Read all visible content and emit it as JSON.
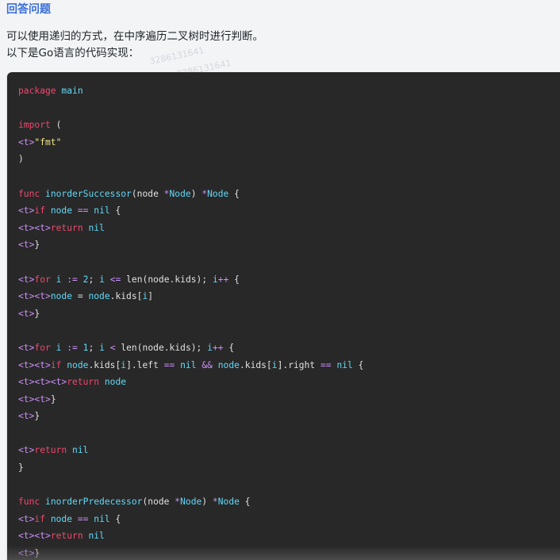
{
  "answer": {
    "heading": "回答问题",
    "intro_line1": "可以使用递归的方式，在中序遍历二叉树时进行判断。",
    "intro_line2": "以下是Go语言的代码实现：",
    "watermark1": "3286131641",
    "watermark2": "3286131641"
  },
  "code": {
    "lines": [
      [
        [
          "kw",
          "package"
        ],
        [
          "pl",
          " "
        ],
        [
          "id",
          "main"
        ]
      ],
      [],
      [
        [
          "kw",
          "import"
        ],
        [
          "pl",
          " ("
        ]
      ],
      [
        [
          "tag",
          "<t>"
        ],
        [
          "str",
          "\"fmt\""
        ]
      ],
      [
        [
          "pl",
          ")"
        ]
      ],
      [],
      [
        [
          "kw",
          "func"
        ],
        [
          "pl",
          " "
        ],
        [
          "id",
          "inorderSuccessor"
        ],
        [
          "pl",
          "(node "
        ],
        [
          "tag",
          "*"
        ],
        [
          "id",
          "Node"
        ],
        [
          "pl",
          ") "
        ],
        [
          "tag",
          "*"
        ],
        [
          "id",
          "Node"
        ],
        [
          "pl",
          " {"
        ]
      ],
      [
        [
          "tag",
          "<t>"
        ],
        [
          "kw",
          "if"
        ],
        [
          "pl",
          " "
        ],
        [
          "id",
          "node"
        ],
        [
          "pl",
          " "
        ],
        [
          "tag",
          "=="
        ],
        [
          "pl",
          " "
        ],
        [
          "id",
          "nil"
        ],
        [
          "pl",
          " {"
        ]
      ],
      [
        [
          "tag",
          "<t><t>"
        ],
        [
          "kw",
          "return"
        ],
        [
          "pl",
          " "
        ],
        [
          "id",
          "nil"
        ]
      ],
      [
        [
          "tag",
          "<t>"
        ],
        [
          "pl",
          "}"
        ]
      ],
      [],
      [
        [
          "tag",
          "<t>"
        ],
        [
          "kw",
          "for"
        ],
        [
          "pl",
          " "
        ],
        [
          "id",
          "i"
        ],
        [
          "pl",
          " "
        ],
        [
          "tag",
          ":="
        ],
        [
          "pl",
          " "
        ],
        [
          "id",
          "2"
        ],
        [
          "pl",
          "; "
        ],
        [
          "id",
          "i"
        ],
        [
          "pl",
          " "
        ],
        [
          "tag",
          "<="
        ],
        [
          "pl",
          " len(node.kids); "
        ],
        [
          "id",
          "i"
        ],
        [
          "tag",
          "++"
        ],
        [
          "pl",
          " {"
        ]
      ],
      [
        [
          "tag",
          "<t><t>"
        ],
        [
          "id",
          "node"
        ],
        [
          "pl",
          " = "
        ],
        [
          "id",
          "node"
        ],
        [
          "pl",
          ".kids["
        ],
        [
          "id",
          "i"
        ],
        [
          "pl",
          "]"
        ]
      ],
      [
        [
          "tag",
          "<t>"
        ],
        [
          "pl",
          "}"
        ]
      ],
      [],
      [
        [
          "tag",
          "<t>"
        ],
        [
          "kw",
          "for"
        ],
        [
          "pl",
          " "
        ],
        [
          "id",
          "i"
        ],
        [
          "pl",
          " "
        ],
        [
          "tag",
          ":="
        ],
        [
          "pl",
          " "
        ],
        [
          "id",
          "1"
        ],
        [
          "pl",
          "; "
        ],
        [
          "id",
          "i"
        ],
        [
          "pl",
          " "
        ],
        [
          "tag",
          "<"
        ],
        [
          "pl",
          " len(node.kids); "
        ],
        [
          "id",
          "i"
        ],
        [
          "tag",
          "++"
        ],
        [
          "pl",
          " {"
        ]
      ],
      [
        [
          "tag",
          "<t><t>"
        ],
        [
          "kw",
          "if"
        ],
        [
          "pl",
          " "
        ],
        [
          "id",
          "node"
        ],
        [
          "pl",
          ".kids["
        ],
        [
          "id",
          "i"
        ],
        [
          "pl",
          "].left "
        ],
        [
          "tag",
          "=="
        ],
        [
          "pl",
          " "
        ],
        [
          "id",
          "nil"
        ],
        [
          "pl",
          " "
        ],
        [
          "tag",
          "&&"
        ],
        [
          "pl",
          " "
        ],
        [
          "id",
          "node"
        ],
        [
          "pl",
          ".kids["
        ],
        [
          "id",
          "i"
        ],
        [
          "pl",
          "].right "
        ],
        [
          "tag",
          "=="
        ],
        [
          "pl",
          " "
        ],
        [
          "id",
          "nil"
        ],
        [
          "pl",
          " {"
        ]
      ],
      [
        [
          "tag",
          "<t><t><t>"
        ],
        [
          "kw",
          "return"
        ],
        [
          "pl",
          " "
        ],
        [
          "id",
          "node"
        ]
      ],
      [
        [
          "tag",
          "<t><t>"
        ],
        [
          "pl",
          "}"
        ]
      ],
      [
        [
          "tag",
          "<t>"
        ],
        [
          "pl",
          "}"
        ]
      ],
      [],
      [
        [
          "tag",
          "<t>"
        ],
        [
          "kw",
          "return"
        ],
        [
          "pl",
          " "
        ],
        [
          "id",
          "nil"
        ]
      ],
      [
        [
          "pl",
          "}"
        ]
      ],
      [],
      [
        [
          "kw",
          "func"
        ],
        [
          "pl",
          " "
        ],
        [
          "id",
          "inorderPredecessor"
        ],
        [
          "pl",
          "(node "
        ],
        [
          "tag",
          "*"
        ],
        [
          "id",
          "Node"
        ],
        [
          "pl",
          ") "
        ],
        [
          "tag",
          "*"
        ],
        [
          "id",
          "Node"
        ],
        [
          "pl",
          " {"
        ]
      ],
      [
        [
          "tag",
          "<t>"
        ],
        [
          "kw",
          "if"
        ],
        [
          "pl",
          " "
        ],
        [
          "id",
          "node"
        ],
        [
          "pl",
          " "
        ],
        [
          "tag",
          "=="
        ],
        [
          "pl",
          " "
        ],
        [
          "id",
          "nil"
        ],
        [
          "pl",
          " {"
        ]
      ],
      [
        [
          "tag",
          "<t><t>"
        ],
        [
          "kw",
          "return"
        ],
        [
          "pl",
          " "
        ],
        [
          "id",
          "nil"
        ]
      ],
      [
        [
          "tag",
          "<t>"
        ],
        [
          "pl",
          "}"
        ]
      ]
    ]
  }
}
